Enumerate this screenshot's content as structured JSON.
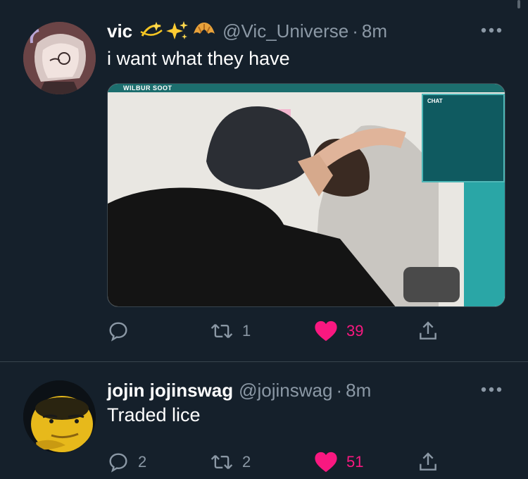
{
  "tweets": [
    {
      "display_name": "vic",
      "emojis": [
        "dizzy-icon",
        "sparkles-icon",
        "croissant-icon"
      ],
      "handle": "@Vic_Universe",
      "separator": "·",
      "time": "8m",
      "text": "i want what they have",
      "media": {
        "window_title": "WILBUR SOOT",
        "chat_title": "CHAT"
      },
      "actions": {
        "reply": "",
        "retweet": "1",
        "like": "39",
        "like_liked": true
      }
    },
    {
      "display_name": "jojin jojinswag",
      "emojis": [],
      "handle": "@jojinswag",
      "separator": "·",
      "time": "8m",
      "text": "Traded lice",
      "actions": {
        "reply": "2",
        "retweet": "2",
        "like": "51",
        "like_liked": true
      }
    }
  ],
  "colors": {
    "background": "#15202b",
    "secondary_text": "#8b98a5",
    "like": "#f91880",
    "divider": "#38444d"
  }
}
